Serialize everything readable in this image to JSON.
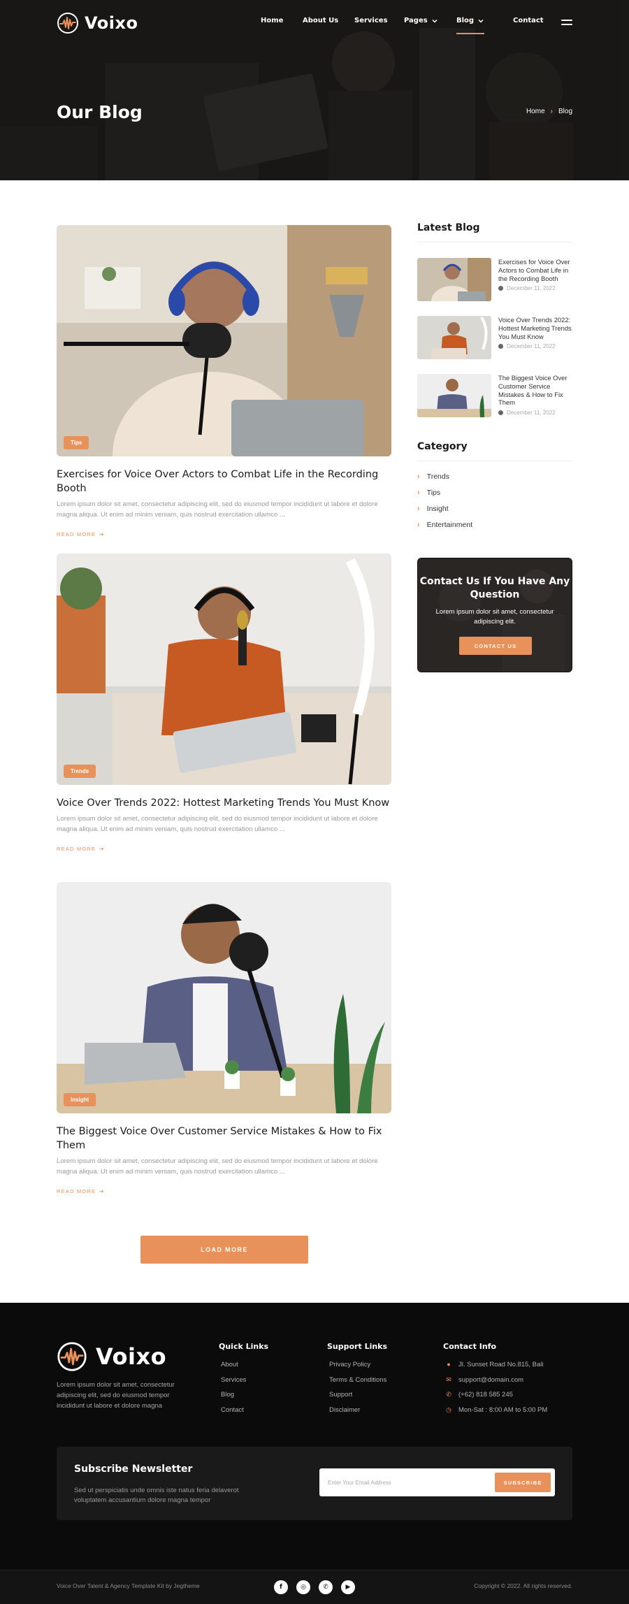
{
  "brand": {
    "name": "Voixo",
    "accent": "#e8915a"
  },
  "nav": {
    "items": [
      {
        "label": "Home"
      },
      {
        "label": "About Us"
      },
      {
        "label": "Services"
      },
      {
        "label": "Pages"
      },
      {
        "label": "Blog",
        "active": true
      },
      {
        "label": "Contact"
      }
    ]
  },
  "hero": {
    "title": "Our Blog",
    "breadcrumb": {
      "home": "Home",
      "current": "Blog"
    }
  },
  "posts": [
    {
      "tag": "Tips",
      "title": "Exercises for Voice Over Actors to Combat Life in the Recording Booth",
      "excerpt": "Lorem ipsum dolor sit amet, consectetur adipiscing elit, sed do eiusmod tempor incididunt ut labore et dolore magna aliqua. Ut enim ad minim veniam, quis nostrud exercitation ullamco ...",
      "read_more": "READ MORE"
    },
    {
      "tag": "Trends",
      "title": "Voice Over Trends 2022: Hottest Marketing Trends You Must Know",
      "excerpt": "Lorem ipsum dolor sit amet, consectetur adipiscing elit, sed do eiusmod tempor incididunt ut labore et dolore magna aliqua. Ut enim ad minim veniam, quis nostrud exercitation ullamco ...",
      "read_more": "READ MORE"
    },
    {
      "tag": "Insight",
      "title": "The Biggest Voice Over Customer Service Mistakes & How to Fix Them",
      "excerpt": "Lorem ipsum dolor sit amet, consectetur adipiscing elit, sed do eiusmod tempor incididunt ut labore et dolore magna aliqua. Ut enim ad minim veniam, quis nostrud exercitation ullamco ...",
      "read_more": "READ MORE"
    }
  ],
  "load_more": "LOAD MORE",
  "sidebar": {
    "latest_title": "Latest Blog",
    "latest": [
      {
        "title": "Exercises for Voice Over Actors to Combat Life in the Recording Booth",
        "date": "December 11, 2022"
      },
      {
        "title": "Voice Over Trends 2022: Hottest Marketing Trends You Must Know",
        "date": "December 11, 2022"
      },
      {
        "title": "The Biggest Voice Over Customer Service Mistakes & How to Fix Them",
        "date": "December 11, 2022"
      }
    ],
    "category_title": "Category",
    "categories": [
      "Trends",
      "Tips",
      "Insight",
      "Entertainment"
    ],
    "contact": {
      "title": "Contact Us If You Have Any Question",
      "text": "Lorem ipsum dolor sit amet, consectetur adipiscing elit.",
      "button": "CONTACT US"
    }
  },
  "footer": {
    "about": "Lorem ipsum dolor sit amet, consectetur adipiscing elit, sed do eiusmod tempor incididunt ut labore et dolore magna",
    "quick_links": {
      "title": "Quick Links",
      "items": [
        "About",
        "Services",
        "Blog",
        "Contact"
      ]
    },
    "support_links": {
      "title": "Support Links",
      "items": [
        "Privacy Policy",
        "Terms & Conditions",
        "Support",
        "Disclaimer"
      ]
    },
    "contact_info": {
      "title": "Contact Info",
      "items": [
        {
          "icon": "map-pin-icon",
          "text": "Jl. Sunset Road No.815, Bali"
        },
        {
          "icon": "mail-icon",
          "text": "support@domain.com"
        },
        {
          "icon": "phone-icon",
          "text": "(+62) 818 585 245"
        },
        {
          "icon": "clock-icon",
          "text": "Mon-Sat : 8:00 AM to 5:00 PM"
        }
      ]
    },
    "newsletter": {
      "title": "Subscribe Newsletter",
      "text": "Sed ut perspiciatis unde omnis iste natus feria delaverot voluptatem accusantium dolore magna tempor",
      "placeholder": "Enter Your Email Address",
      "button": "SUBSCRIBE"
    },
    "bottom_left": "Voice Over Talent & Agency Template Kit by Jegtheme",
    "bottom_right": "Copyright © 2022. All rights reserved.",
    "socials": [
      {
        "icon": "facebook-icon",
        "glyph": "f"
      },
      {
        "icon": "instagram-icon",
        "glyph": "◎"
      },
      {
        "icon": "whatsapp-icon",
        "glyph": "✆"
      },
      {
        "icon": "youtube-icon",
        "glyph": "▶"
      }
    ]
  }
}
